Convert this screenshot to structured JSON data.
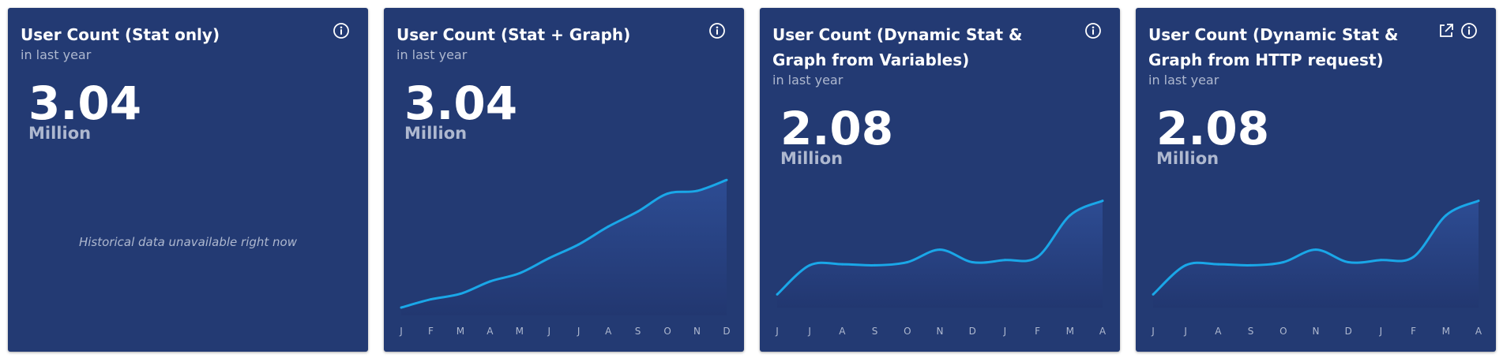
{
  "colors": {
    "card_bg": "#233a73",
    "line": "#1aa7e8",
    "muted": "#aeb8cf"
  },
  "cards": [
    {
      "title": "User Count (Stat only)",
      "subtitle": "in last year",
      "stat_value": "3.04",
      "stat_unit": "Million",
      "empty_message": "Historical data unavailable right now",
      "icons": [
        "info-icon"
      ]
    },
    {
      "title": "User Count (Stat + Graph)",
      "subtitle": "in last year",
      "stat_value": "3.04",
      "stat_unit": "Million",
      "icons": [
        "info-icon"
      ]
    },
    {
      "title": "User Count (Dynamic Stat & Graph from Variables)",
      "subtitle": "in last year",
      "stat_value": "2.08",
      "stat_unit": "Million",
      "icons": [
        "info-icon"
      ]
    },
    {
      "title": "User Count (Dynamic Stat & Graph from HTTP request)",
      "subtitle": "in last year",
      "stat_value": "2.08",
      "stat_unit": "Million",
      "icons": [
        "external-link-icon",
        "info-icon"
      ]
    }
  ],
  "chart_data": [
    {
      "type": "area",
      "categories": [
        "J",
        "F",
        "M",
        "A",
        "M",
        "J",
        "J",
        "A",
        "S",
        "O",
        "N",
        "D"
      ],
      "values": [
        0.0,
        0.6,
        1.0,
        1.9,
        2.5,
        3.6,
        4.6,
        5.9,
        7.0,
        8.3,
        8.5,
        9.3
      ],
      "grid": false,
      "legend": "none",
      "line_color": "#1aa7e8"
    },
    {
      "type": "area",
      "categories": [
        "J",
        "J",
        "A",
        "S",
        "O",
        "N",
        "D",
        "J",
        "F",
        "M",
        "A"
      ],
      "values": [
        0.5,
        3.3,
        3.4,
        3.3,
        3.6,
        4.8,
        3.6,
        3.8,
        4.1,
        8.1,
        9.5
      ],
      "grid": false,
      "legend": "none",
      "line_color": "#1aa7e8"
    },
    {
      "type": "area",
      "categories": [
        "J",
        "J",
        "A",
        "S",
        "O",
        "N",
        "D",
        "J",
        "F",
        "M",
        "A"
      ],
      "values": [
        0.5,
        3.3,
        3.4,
        3.3,
        3.6,
        4.8,
        3.6,
        3.8,
        4.1,
        8.1,
        9.5
      ],
      "grid": false,
      "legend": "none",
      "line_color": "#1aa7e8"
    }
  ]
}
